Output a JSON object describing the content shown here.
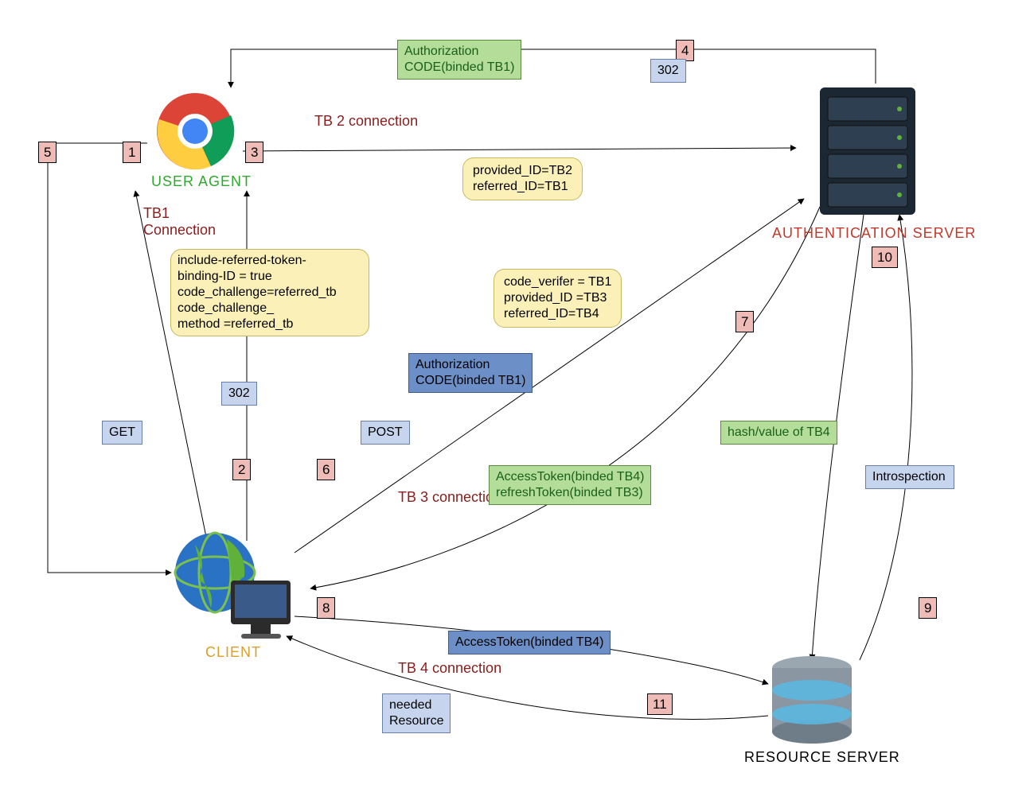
{
  "actors": {
    "user_agent": "USER AGENT",
    "client": "CLIENT",
    "auth_server": "AUTHENTICATION SERVER",
    "resource_server": "RESOURCE SERVER"
  },
  "connections": {
    "tb1": "TB1\nConnection",
    "tb2": "TB 2 connection",
    "tb3": "TB 3 connection",
    "tb4": "TB 4 connection"
  },
  "steps": {
    "s1": "1",
    "s2": "2",
    "s3": "3",
    "s4": "4",
    "s5": "5",
    "s6": "6",
    "s7": "7",
    "s8": "8",
    "s9": "9",
    "s10": "10",
    "s11": "11"
  },
  "http": {
    "get": "GET",
    "post": "POST",
    "r302a": "302",
    "r302b": "302",
    "introspection": "Introspection"
  },
  "msgs": {
    "auth_code_green": "Authorization\nCODE(binded TB1)",
    "auth_code_blue": "Authorization\nCODE(binded TB1)",
    "tokens": "AccessToken(binded TB4)\nrefreshToken(binded TB3)",
    "access_token": "AccessToken(binded TB4)",
    "hash_tb4": "hash/value of TB4",
    "needed_resource": "needed\nResource"
  },
  "notes": {
    "note1": "include-referred-token-\nbinding-ID = true\ncode_challenge=referred_tb\ncode_challenge_\nmethod =referred_tb",
    "note2": "provided_ID=TB2\nreferred_ID=TB1",
    "note3": "code_verifer = TB1\nprovided_ID =TB3\nreferred_ID=TB4"
  }
}
